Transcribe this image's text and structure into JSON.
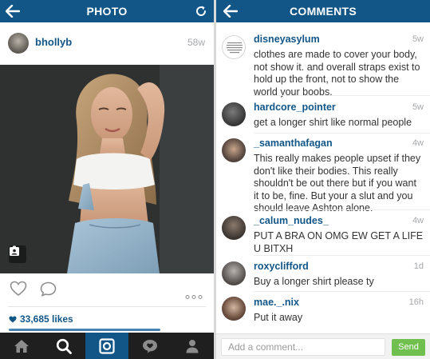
{
  "colors": {
    "header_bg": "#125688",
    "link_blue": "#125688",
    "tabbar_bg": "#1f1f1f",
    "send_green": "#70c050",
    "timestamp_gray": "#a5a7aa"
  },
  "photo_screen": {
    "header": {
      "title": "PHOTO",
      "back_icon": "arrow-left-icon",
      "refresh_icon": "refresh-icon"
    },
    "post": {
      "username": "bhollyb",
      "time": "58w",
      "likes": "33,685 likes",
      "photo_icon": "people-tag-icon"
    },
    "actions": {
      "like_icon": "heart-outline-icon",
      "comment_icon": "comment-bubble-icon",
      "more_icon": "ellipsis-icon"
    },
    "tabs": [
      {
        "name": "home",
        "icon": "home-icon",
        "active": false
      },
      {
        "name": "explore",
        "icon": "search-icon",
        "active": false
      },
      {
        "name": "camera",
        "icon": "camera-icon",
        "active": true
      },
      {
        "name": "activity",
        "icon": "activity-bubble-icon",
        "active": false
      },
      {
        "name": "profile",
        "icon": "person-icon",
        "active": false
      }
    ]
  },
  "comments_screen": {
    "header": {
      "title": "COMMENTS",
      "back_icon": "arrow-left-icon"
    },
    "comments": [
      {
        "user": "disneyasylum",
        "time": "5w",
        "text": "clothes are made to cover your body, not show it. and overall straps exist to hold up the front, not to show the world your boobs."
      },
      {
        "user": "hardcore_pointer",
        "time": "5w",
        "text": "get a longer shirt like normal people"
      },
      {
        "user": "_samanthafagan",
        "time": "4w",
        "text": "This really makes people upset if they don't like their bodies. This really shouldn't be out there but if you want it to be, fine. But your a slut and you should leave Ashton alone."
      },
      {
        "user": "_calum_nudes_",
        "time": "4w",
        "text": "PUT A BRA ON OMG EW GET A LIFE U BITXH"
      },
      {
        "user": "roxyclifford",
        "time": "1d",
        "text": "Buy a longer shirt please ty"
      },
      {
        "user": "mae._.nix",
        "time": "16h",
        "text": "Put it away"
      }
    ],
    "compose": {
      "placeholder": "Add a comment...",
      "send_label": "Send"
    }
  }
}
